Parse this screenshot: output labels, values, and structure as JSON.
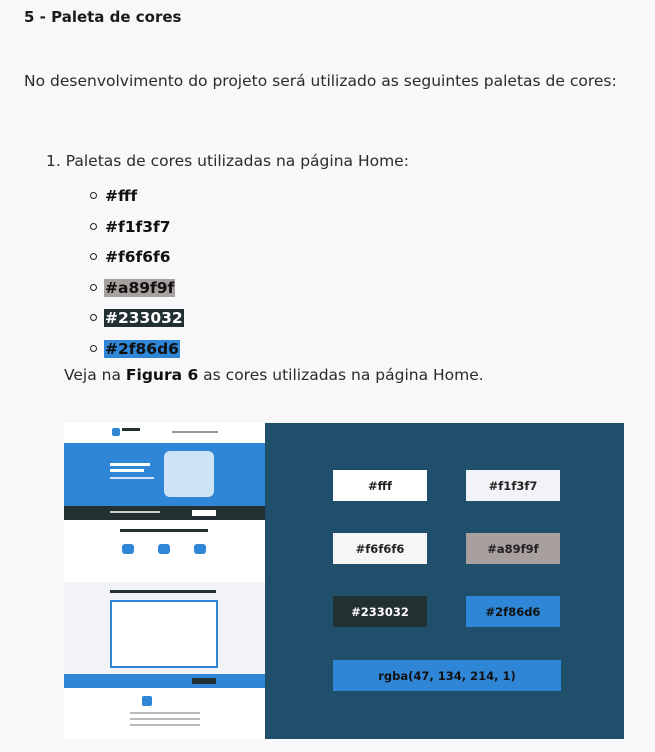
{
  "section_title": "5 - Paleta de cores",
  "intro": "No desenvolvimento do projeto será utilizado as seguintes paletas de cores:",
  "list_item": "1. Paletas de cores utilizadas na página Home:",
  "colors": [
    {
      "code": "#fff",
      "highlight": ""
    },
    {
      "code": "#f1f3f7",
      "highlight": ""
    },
    {
      "code": "#f6f6f6",
      "highlight": ""
    },
    {
      "code": "#a89f9f",
      "highlight": "#a89f9f",
      "text_color": "#111"
    },
    {
      "code": "#233032",
      "highlight": "#233032",
      "text_color": "#ffffff"
    },
    {
      "code": "#2f86d6",
      "highlight": "#2f86d6",
      "text_color": "#111"
    }
  ],
  "see_prefix": "Veja na ",
  "see_bold": "Figura 6",
  "see_suffix": " as cores utilizadas na página Home.",
  "figure": {
    "swatches": [
      {
        "label": "#fff",
        "bg": "#ffffff",
        "fg": "#222222"
      },
      {
        "label": "#f1f3f7",
        "bg": "#f1f3f7",
        "fg": "#222222"
      },
      {
        "label": "#f6f6f6",
        "bg": "#f6f6f6",
        "fg": "#222222"
      },
      {
        "label": "#a89f9f",
        "bg": "#a89f9f",
        "fg": "#222222"
      },
      {
        "label": "#233032",
        "bg": "#233032",
        "fg": "#ffffff"
      },
      {
        "label": "#2f86d6",
        "bg": "#2f86d6",
        "fg": "#111111"
      },
      {
        "label": "rgba(47, 134, 214, 1)",
        "bg": "#2f86d6",
        "fg": "#111111"
      }
    ]
  }
}
